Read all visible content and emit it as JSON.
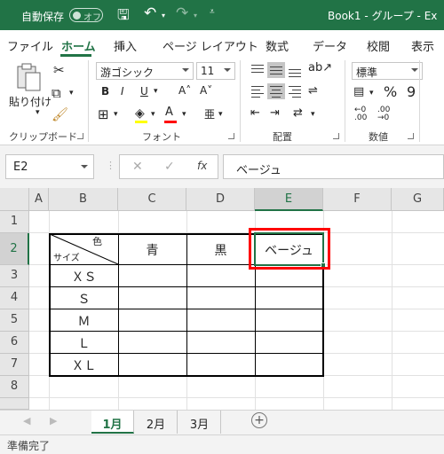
{
  "titlebar": {
    "autosave_label": "自動保存",
    "autosave_state": "オフ",
    "title": "Book1 - グループ - Ex"
  },
  "tabs": [
    "ファイル",
    "ホーム",
    "挿入",
    "ページ レイアウト",
    "数式",
    "データ",
    "校閲",
    "表示"
  ],
  "ribbon": {
    "clipboard": {
      "paste_label": "貼り付け",
      "group_label": "クリップボード"
    },
    "font": {
      "font_name": "游ゴシック",
      "font_size": "11",
      "group_label": "フォント",
      "bold": "B",
      "italic": "I",
      "underline": "U",
      "grow": "A˄",
      "shrink": "A˅",
      "font_color": "#ff0000",
      "fill_color": "#ffff00"
    },
    "alignment": {
      "group_label": "配置"
    },
    "number": {
      "format": "標準",
      "percent": "%",
      "comma": "9",
      "group_label": "数値"
    }
  },
  "formula_bar": {
    "name_box": "E2",
    "fx": "fx",
    "content": "ベージュ"
  },
  "columns": [
    "A",
    "B",
    "C",
    "D",
    "E",
    "F",
    "G"
  ],
  "rows": [
    "1",
    "2",
    "3",
    "4",
    "5",
    "6",
    "7",
    "8"
  ],
  "table": {
    "header_top": "色",
    "header_bottom": "サイズ",
    "colors": [
      "青",
      "黒",
      "ベージュ"
    ],
    "sizes": [
      "ＸＳ",
      "Ｓ",
      "Ｍ",
      "Ｌ",
      "ＸＬ"
    ]
  },
  "sheets": [
    "1月",
    "2月",
    "3月"
  ],
  "status": "準備完了",
  "accent": "#217346",
  "highlight": "#ff0000"
}
